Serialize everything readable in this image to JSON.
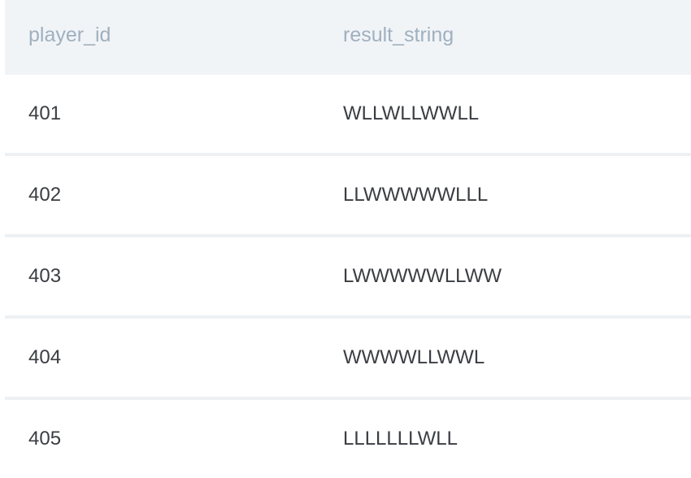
{
  "table": {
    "columns": [
      "player_id",
      "result_string"
    ],
    "rows": [
      {
        "player_id": "401",
        "result_string": "WLLWLLWWLL"
      },
      {
        "player_id": "402",
        "result_string": "LLWWWWWLLL"
      },
      {
        "player_id": "403",
        "result_string": "LWWWWWLLWW"
      },
      {
        "player_id": "404",
        "result_string": "WWWWLLWWL"
      },
      {
        "player_id": "405",
        "result_string": "LLLLLLLWLL"
      }
    ]
  },
  "colors": {
    "header_background": "#f1f4f7",
    "header_text": "#9fb0bf",
    "cell_text": "#3a3d42",
    "row_divider": "#eef1f4"
  }
}
